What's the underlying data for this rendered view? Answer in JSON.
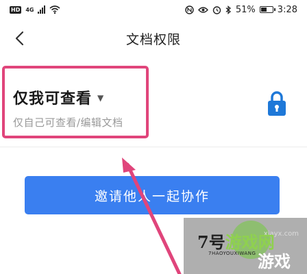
{
  "status_bar": {
    "hd": "HD",
    "network": "4G",
    "battery": "51%",
    "battery_level": 0.51,
    "time": "3:28"
  },
  "nav": {
    "title": "文档权限"
  },
  "permission": {
    "title": "仅我可查看",
    "description": "仅自己可查看/编辑文档",
    "highlight_color": "#e0457b"
  },
  "invite": {
    "label": "邀请他人一起协作",
    "color": "#3a7ff0"
  },
  "watermark": {
    "url": "xiayx.com",
    "line1_num": "7",
    "line1_a": "号",
    "line1_b": "游戏",
    "line1_c": "网",
    "sub": "7HAOYOUXIWANG",
    "line2": "游戏"
  }
}
